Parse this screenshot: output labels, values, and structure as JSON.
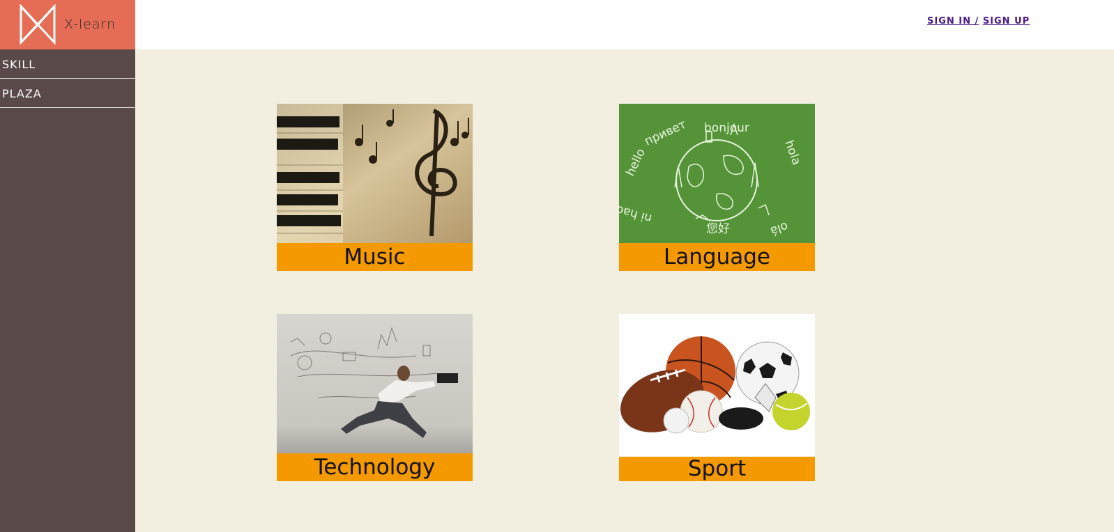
{
  "brand": {
    "name": "X-learn"
  },
  "sidebar": {
    "items": [
      {
        "label": "SKILL"
      },
      {
        "label": "PLAZA"
      }
    ]
  },
  "header": {
    "sign_in": "SIGN IN /",
    "sign_up": "SIGN UP"
  },
  "categories": [
    {
      "label": "Music",
      "image": "piano-music-notes-image"
    },
    {
      "label": "Language",
      "image": "world-greetings-chalkboard-image",
      "image_text": [
        "hello",
        "привет",
        "bonjour",
        "hola",
        "ni hao",
        "您好",
        "olá"
      ]
    },
    {
      "label": "Technology",
      "image": "businessman-running-laptop-image"
    },
    {
      "label": "Sport",
      "image": "sports-balls-image"
    }
  ],
  "colors": {
    "logo_bg": "#e56c55",
    "sidebar_bg": "#594948",
    "page_bg": "#f3efe0",
    "label_bg": "#f49900",
    "link": "#4b1a8a"
  }
}
